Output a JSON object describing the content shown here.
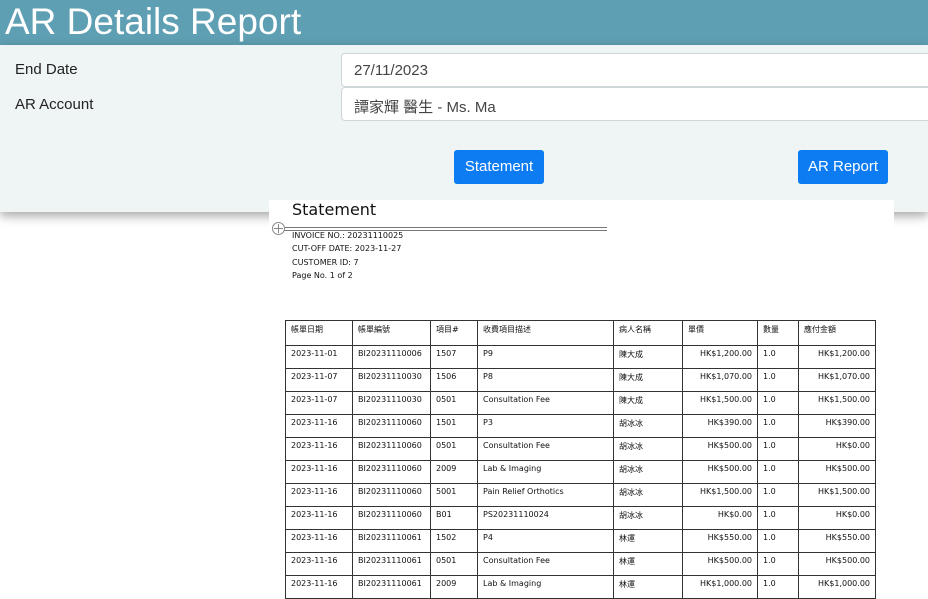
{
  "header": {
    "title": "AR Details Report"
  },
  "form": {
    "end_date_label": "End Date",
    "end_date_value": "27/11/2023",
    "ar_account_label": "AR Account",
    "ar_account_value": "譚家輝 醫生 - Ms. Ma",
    "statement_button": "Statement",
    "ar_report_button": "AR Report"
  },
  "report": {
    "title": "Statement",
    "invoice_no": "INVOICE NO.: 20231110025",
    "cutoff_date": "CUT-OFF DATE: 2023-11-27",
    "customer_id": "CUSTOMER ID: 7",
    "page_no": "Page No. 1  of 2",
    "columns": [
      "帳單日期",
      "帳單編號",
      "項目#",
      "收費項目描述",
      "病人名稱",
      "單價",
      "數量",
      "應付金額"
    ],
    "rows": [
      [
        "2023-11-01",
        "BI20231110006",
        "1507",
        "P9",
        "陳大成",
        "HK$1,200.00",
        "1.0",
        "HK$1,200.00"
      ],
      [
        "2023-11-07",
        "BI20231110030",
        "1506",
        "P8",
        "陳大成",
        "HK$1,070.00",
        "1.0",
        "HK$1,070.00"
      ],
      [
        "2023-11-07",
        "BI20231110030",
        "0501",
        "Consultation Fee",
        "陳大成",
        "HK$1,500.00",
        "1.0",
        "HK$1,500.00"
      ],
      [
        "2023-11-16",
        "BI20231110060",
        "1501",
        "P3",
        "胡冰冰",
        "HK$390.00",
        "1.0",
        "HK$390.00"
      ],
      [
        "2023-11-16",
        "BI20231110060",
        "0501",
        "Consultation Fee",
        "胡冰冰",
        "HK$500.00",
        "1.0",
        "HK$0.00"
      ],
      [
        "2023-11-16",
        "BI20231110060",
        "2009",
        "Lab & Imaging",
        "胡冰冰",
        "HK$500.00",
        "1.0",
        "HK$500.00"
      ],
      [
        "2023-11-16",
        "BI20231110060",
        "5001",
        "Pain Relief Orthotics",
        "胡冰冰",
        "HK$1,500.00",
        "1.0",
        "HK$1,500.00"
      ],
      [
        "2023-11-16",
        "BI20231110060",
        "B01",
        "PS20231110024",
        "胡冰冰",
        "HK$0.00",
        "1.0",
        "HK$0.00"
      ],
      [
        "2023-11-16",
        "BI20231110061",
        "1502",
        "P4",
        "林運",
        "HK$550.00",
        "1.0",
        "HK$550.00"
      ],
      [
        "2023-11-16",
        "BI20231110061",
        "0501",
        "Consultation Fee",
        "林運",
        "HK$500.00",
        "1.0",
        "HK$500.00"
      ],
      [
        "2023-11-16",
        "BI20231110061",
        "2009",
        "Lab & Imaging",
        "林運",
        "HK$1,000.00",
        "1.0",
        "HK$1,000.00"
      ]
    ]
  }
}
